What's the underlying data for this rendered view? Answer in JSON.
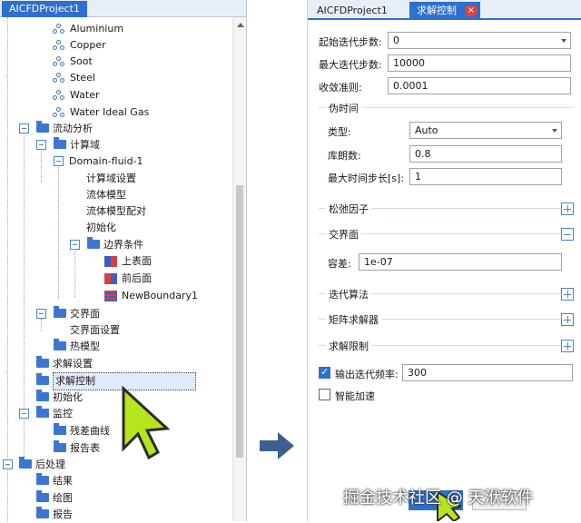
{
  "left_panel": {
    "tab": "AICFDProject1",
    "tree": [
      {
        "label": "Aluminium"
      },
      {
        "label": "Copper"
      },
      {
        "label": "Soot"
      },
      {
        "label": "Steel"
      },
      {
        "label": "Water"
      },
      {
        "label": "Water Ideal Gas"
      },
      {
        "label": "流动分析"
      },
      {
        "label": "计算域"
      },
      {
        "label": "Domain-fluid-1"
      },
      {
        "label": "计算域设置"
      },
      {
        "label": "流体模型"
      },
      {
        "label": "流体模型配对"
      },
      {
        "label": "初始化"
      },
      {
        "label": "边界条件"
      },
      {
        "label": "上表面"
      },
      {
        "label": "前后面"
      },
      {
        "label": "NewBoundary1"
      },
      {
        "label": "交界面"
      },
      {
        "label": "交界面设置"
      },
      {
        "label": "热模型"
      },
      {
        "label": "求解设置"
      },
      {
        "label": "求解控制"
      },
      {
        "label": "初始化"
      },
      {
        "label": "监控"
      },
      {
        "label": "残差曲线"
      },
      {
        "label": "报告表"
      },
      {
        "label": "后处理"
      },
      {
        "label": "结果"
      },
      {
        "label": "绘图"
      },
      {
        "label": "报告"
      }
    ]
  },
  "right_panel": {
    "tabs": [
      "AICFDProject1",
      "求解控制"
    ],
    "close_icon": "×",
    "fields": {
      "start_iter_label": "起始迭代步数:",
      "start_iter_value": "0",
      "max_iter_label": "最大迭代步数:",
      "max_iter_value": "10000",
      "convergence_label": "收敛准则:",
      "convergence_value": "0.0001"
    },
    "pseudo_time": {
      "title": "伪时间",
      "type_label": "类型:",
      "type_value": "Auto",
      "courant_label": "库朗数:",
      "courant_value": "0.8",
      "max_dt_label": "最大时间步长[s]:",
      "max_dt_value": "1"
    },
    "relax": {
      "title": "松弛因子"
    },
    "interface": {
      "title": "交界面",
      "tol_label": "容差:",
      "tol_value": "1e-07"
    },
    "iter_alg": {
      "title": "迭代算法"
    },
    "matrix_solver": {
      "title": "矩阵求解器"
    },
    "solve_limit": {
      "title": "求解限制"
    },
    "output_freq": {
      "label": "输出迭代频率:",
      "value": "300",
      "checked": true
    },
    "smart_accel": {
      "label": "智能加速",
      "checked": false
    }
  },
  "watermark": "掘金技术社区 @ 天洑软件",
  "colors": {
    "accent": "#2e6fd0",
    "folder": "#3d76d1",
    "cursor": "#b5e61d"
  }
}
